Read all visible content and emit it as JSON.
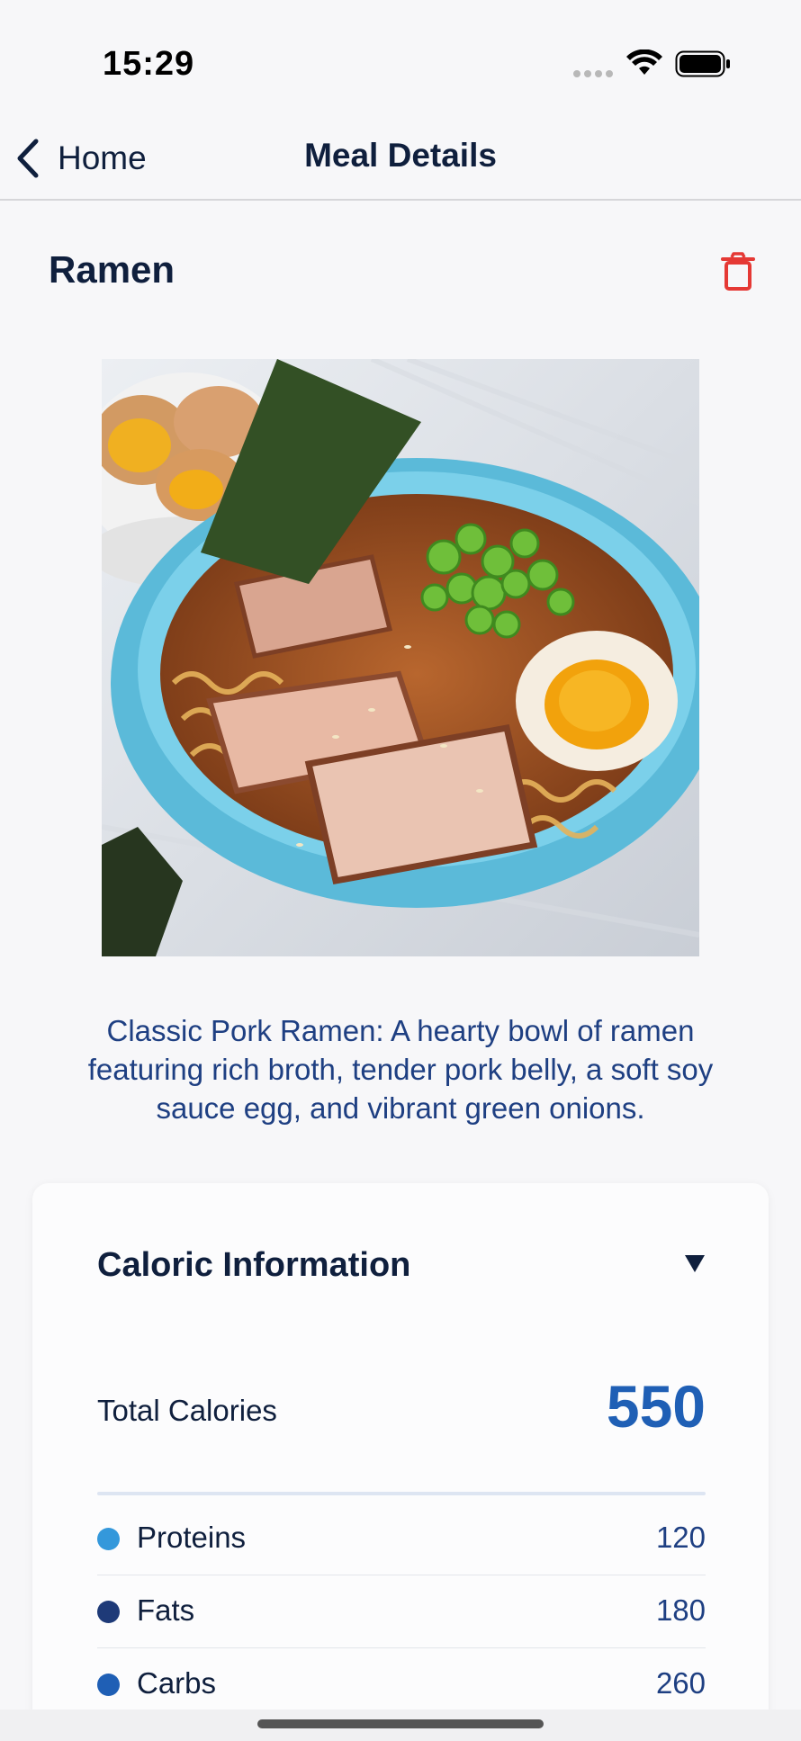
{
  "status_bar": {
    "time": "15:29"
  },
  "nav": {
    "back_label": "Home",
    "title": "Meal Details"
  },
  "meal": {
    "name": "Ramen",
    "description": "Classic Pork Ramen: A hearty bowl of ramen featuring rich broth, tender pork belly, a soft soy sauce egg, and vibrant green onions.",
    "photo_icon": "ramen-bowl-photo"
  },
  "caloric_info": {
    "title": "Caloric Information",
    "total_label": "Total Calories",
    "total_value": "550",
    "macros": [
      {
        "label": "Proteins",
        "value": "120",
        "color": "#3498db"
      },
      {
        "label": "Fats",
        "value": "180",
        "color": "#1e3a78"
      },
      {
        "label": "Carbs",
        "value": "260",
        "color": "#1f5fb5"
      }
    ]
  },
  "colors": {
    "accent": "#1f5fb5",
    "delete": "#e53935",
    "text_dark": "#0f1f3d",
    "text_blue": "#1e3f82"
  }
}
